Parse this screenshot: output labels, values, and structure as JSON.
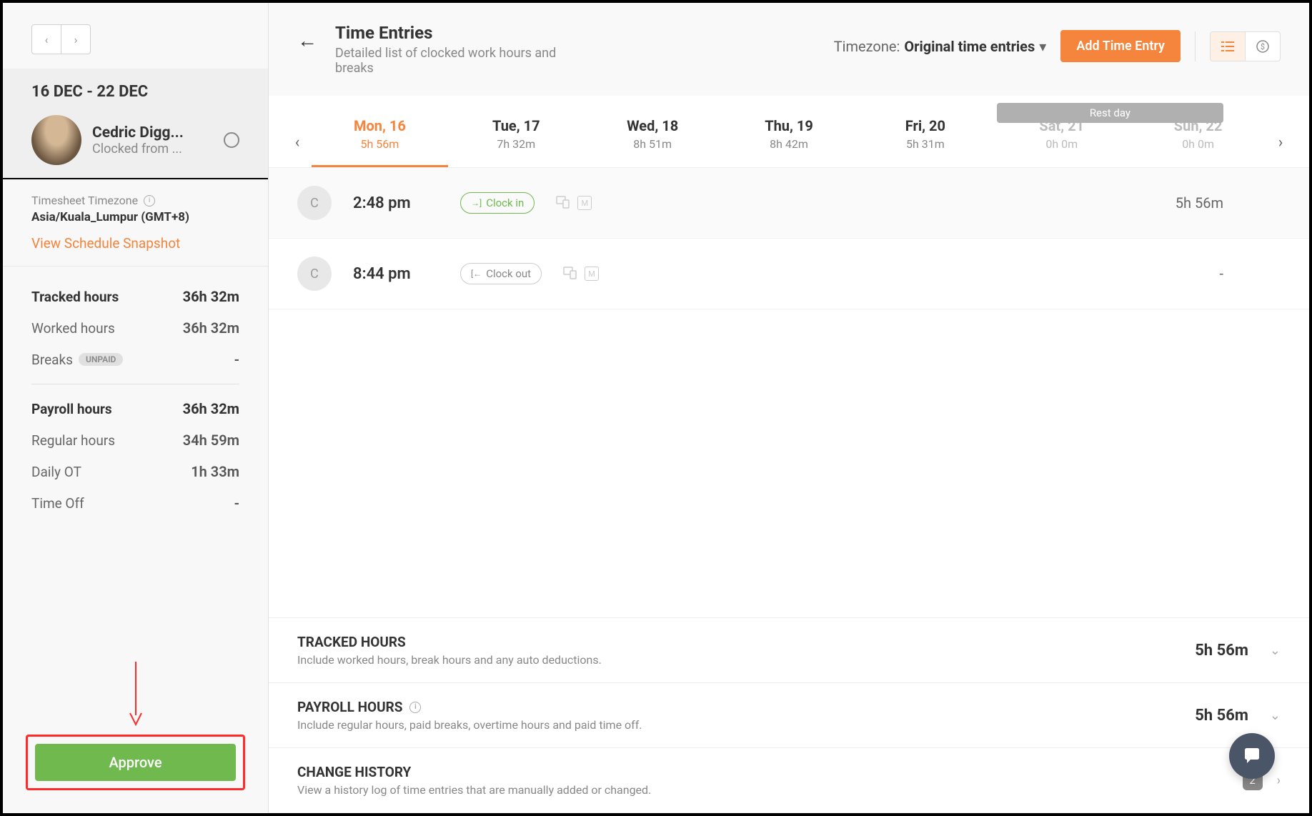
{
  "sidebar": {
    "date_range": "16 DEC - 22 DEC",
    "user_name": "Cedric Digg...",
    "user_status": "Clocked from ...",
    "tz_label": "Timesheet Timezone",
    "tz_value": "Asia/Kuala_Lumpur (GMT+8)",
    "snapshot_link": "View Schedule Snapshot",
    "stats": {
      "tracked_label": "Tracked hours",
      "tracked_value": "36h 32m",
      "worked_label": "Worked hours",
      "worked_value": "36h 32m",
      "breaks_label": "Breaks",
      "breaks_badge": "UNPAID",
      "breaks_value": "-",
      "payroll_label": "Payroll hours",
      "payroll_value": "36h 32m",
      "regular_label": "Regular hours",
      "regular_value": "34h 59m",
      "ot_label": "Daily OT",
      "ot_value": "1h 33m",
      "timeoff_label": "Time Off",
      "timeoff_value": "-"
    },
    "approve_label": "Approve"
  },
  "header": {
    "title": "Time Entries",
    "subtitle": "Detailed list of clocked work hours and breaks",
    "tz_prefix": "Timezone: ",
    "tz_value": "Original time entries",
    "add_button": "Add Time Entry"
  },
  "days": {
    "rest_badge": "Rest day",
    "tabs": [
      {
        "name": "Mon, 16",
        "hours": "5h 56m",
        "active": true
      },
      {
        "name": "Tue, 17",
        "hours": "7h 32m"
      },
      {
        "name": "Wed, 18",
        "hours": "8h 51m"
      },
      {
        "name": "Thu, 19",
        "hours": "8h 42m"
      },
      {
        "name": "Fri, 20",
        "hours": "5h 31m"
      },
      {
        "name": "Sat, 21",
        "hours": "0h 0m",
        "rest": true
      },
      {
        "name": "Sun, 22",
        "hours": "0h 0m",
        "rest": true
      }
    ]
  },
  "entries": [
    {
      "avatar": "C",
      "time": "2:48 pm",
      "badge": "Clock in",
      "type": "in",
      "duration": "5h 56m",
      "icon_m": "M"
    },
    {
      "avatar": "C",
      "time": "8:44 pm",
      "badge": "Clock out",
      "type": "out",
      "duration": "-",
      "icon_m": "M"
    }
  ],
  "sections": {
    "tracked": {
      "title": "TRACKED HOURS",
      "desc": "Include worked hours, break hours and any auto deductions.",
      "value": "5h 56m"
    },
    "payroll": {
      "title": "PAYROLL HOURS",
      "desc": "Include regular hours, paid breaks, overtime hours and paid time off.",
      "value": "5h 56m"
    },
    "history": {
      "title": "CHANGE HISTORY",
      "desc": "View a history log of time entries that are manually added or changed.",
      "count": "2"
    }
  }
}
